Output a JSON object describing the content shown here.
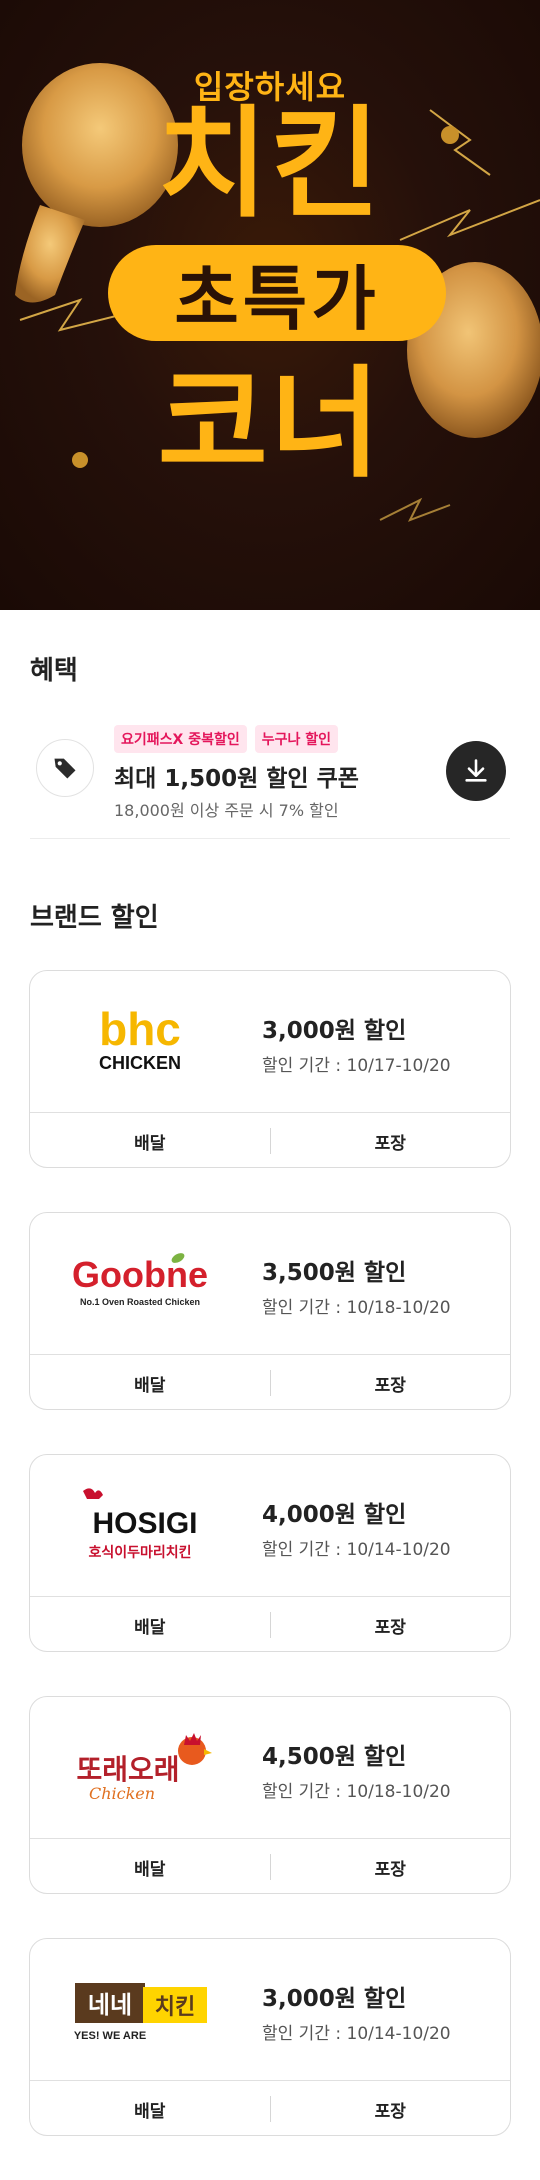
{
  "hero": {
    "subtitle": "입장하세요",
    "line1": "치킨",
    "pill": "초특가",
    "line3": "코너"
  },
  "benefit": {
    "title": "혜택",
    "badges": [
      "요기패스X 중복할인",
      "누구나 할인"
    ],
    "coupon_title": "최대 1,500원 할인 쿠폰",
    "coupon_desc": "18,000원 이상 주문 시 7% 할인",
    "icons": {
      "tag": "tag-icon",
      "download": "download-icon"
    }
  },
  "brands": {
    "title": "브랜드 할인",
    "actions": {
      "delivery": "배달",
      "pickup": "포장"
    },
    "items": [
      {
        "logo_line1": "bhc",
        "logo_line2": "CHICKEN",
        "deal": "3,000원 할인",
        "period": "할인 기간 : 10/17-10/20"
      },
      {
        "logo_line1": "Goobne",
        "logo_line2": "No.1 Oven Roasted Chicken",
        "deal": "3,500원 할인",
        "period": "할인 기간 : 10/18-10/20"
      },
      {
        "logo_line1": "HOSIGI",
        "logo_line2": "호식이두마리치킨",
        "deal": "4,000원 할인",
        "period": "할인 기간 : 10/14-10/20"
      },
      {
        "logo_line1": "또래오래",
        "logo_line2": "Chicken",
        "deal": "4,500원 할인",
        "period": "할인 기간 : 10/18-10/20"
      },
      {
        "logo_line1": "네네",
        "logo_line1b": "치킨",
        "logo_line2": "YES! WE ARE",
        "deal": "3,000원 할인",
        "period": "할인 기간 : 10/14-10/20"
      }
    ]
  },
  "colors": {
    "hero_yellow": "#ffb415",
    "hero_bg": "#25100a",
    "badge_pink": "#e4165b",
    "bhc_yellow": "#f6b700",
    "goobne_red": "#d4202c",
    "goobne_green": "#7cb342",
    "hosigi_red": "#c8102e",
    "ttorae_red": "#b3202a",
    "nene_brown": "#5a3a1e",
    "nene_yellow": "#ffd400"
  }
}
